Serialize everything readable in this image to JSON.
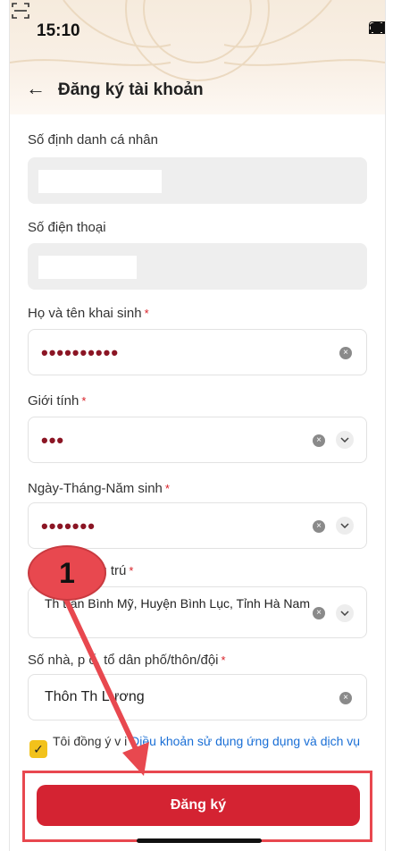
{
  "status_bar": {
    "time": "15:10"
  },
  "nav": {
    "title": "Đăng ký tài khoản"
  },
  "fields": [
    {
      "label": "Số định danh cá nhân",
      "required": false,
      "value": "",
      "state": "disabled"
    },
    {
      "label": "Số điện thoại",
      "required": false,
      "value": "",
      "state": "disabled"
    },
    {
      "label": "Họ và tên khai sinh",
      "required": true,
      "value": "••••••••••",
      "state": "enabled"
    },
    {
      "label": "Giới tính",
      "required": true,
      "value": "•••",
      "state": "enabled"
    },
    {
      "label": "Ngày-Tháng-Năm sinh",
      "required": true,
      "value": "•••••••",
      "state": "enabled"
    },
    {
      "label": "ng trú",
      "required": true,
      "value": "Th  trấn Bình Mỹ, Huyện Bình Lục, Tỉnh Hà Nam",
      "state": "enabled"
    },
    {
      "label": "Số nhà, p  ố, tổ dân phố/thôn/đội",
      "required": true,
      "value": "Thôn Th  Lương",
      "state": "enabled"
    }
  ],
  "required_mark": "*",
  "agreement": {
    "prefix": "Tôi đồng ý v  i ",
    "link": "Điều khoản sử dụng ứng dụng và dịch vụ"
  },
  "submit_label": "Đăng ký",
  "annotation": {
    "step_number": "1",
    "accent": "#e8484f"
  },
  "colors": {
    "primary": "#d42332",
    "link": "#1a6fd6",
    "checkbox": "#f2c21b"
  }
}
